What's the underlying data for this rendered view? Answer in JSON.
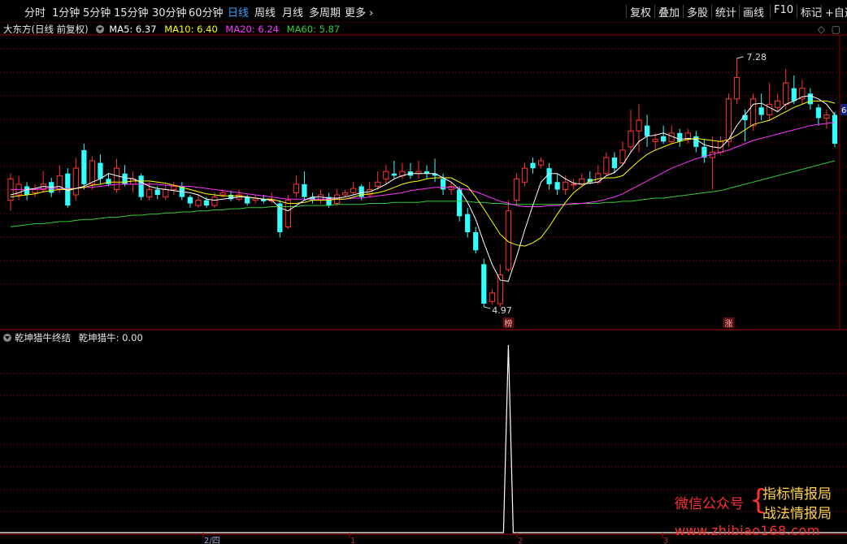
{
  "toolbar": {
    "periods": [
      "分时",
      "1分钟",
      "5分钟",
      "15分钟",
      "30分钟",
      "60分钟",
      "日线",
      "周线",
      "月线",
      "多周期",
      "更多"
    ],
    "active": "日线",
    "right": [
      "复权",
      "叠加",
      "多股",
      "统计",
      "画线",
      "F10",
      "标记",
      "+自选"
    ]
  },
  "header": {
    "stock": "大东方(日线 前复权)",
    "ma5": "MA5: 6.37",
    "ma10": "MA10: 6.40",
    "ma20": "MA20: 6.24",
    "ma60": "MA60: 5.87"
  },
  "colors": {
    "ma5": "#ffffff",
    "ma10": "#ffff00",
    "ma20": "#ff33ff",
    "ma60": "#33cc33",
    "up": "#ff3333",
    "down": "#33ffff",
    "grid": "#8b0000"
  },
  "annotations": {
    "high": "7.28",
    "low": "4.97",
    "badge1": "榜",
    "badge2": "涨",
    "axis_right": "6"
  },
  "indicator": {
    "title": "乾坤猎牛终结",
    "value": "乾坤猎牛: 0.00"
  },
  "xaxis": {
    "labels": [
      "2/四",
      "1",
      "2",
      "3"
    ]
  },
  "watermark": {
    "label": "微信公众号",
    "line1": "指标情报局",
    "line2": "战法情报局",
    "url": "www.zhibiao168.com"
  },
  "chart_data": {
    "type": "candlestick",
    "ylim": [
      4.82,
      7.5
    ],
    "candles": [
      [
        5.95,
        6.15,
        6.2,
        5.85
      ],
      [
        6.0,
        6.1,
        6.18,
        5.95
      ],
      [
        6.08,
        6.0,
        6.12,
        5.95
      ],
      [
        6.02,
        6.05,
        6.1,
        5.98
      ],
      [
        6.05,
        6.1,
        6.22,
        6.02
      ],
      [
        6.12,
        6.02,
        6.16,
        5.98
      ],
      [
        6.05,
        6.18,
        6.28,
        6.02
      ],
      [
        6.2,
        5.9,
        6.25,
        5.88
      ],
      [
        6.0,
        6.25,
        6.35,
        5.95
      ],
      [
        6.42,
        6.1,
        6.48,
        6.05
      ],
      [
        6.1,
        6.32,
        6.36,
        6.05
      ],
      [
        6.3,
        6.15,
        6.38,
        6.1
      ],
      [
        6.15,
        6.1,
        6.2,
        6.08
      ],
      [
        6.05,
        6.25,
        6.34,
        6.02
      ],
      [
        6.2,
        6.1,
        6.28,
        6.08
      ],
      [
        6.1,
        6.15,
        6.22,
        6.02
      ],
      [
        6.18,
        5.98,
        6.2,
        5.95
      ],
      [
        5.98,
        6.05,
        6.12,
        5.95
      ],
      [
        6.05,
        6.0,
        6.08,
        5.96
      ],
      [
        5.98,
        6.05,
        6.1,
        5.95
      ],
      [
        6.05,
        6.08,
        6.12,
        6.0
      ],
      [
        6.08,
        5.98,
        6.12,
        5.95
      ],
      [
        5.98,
        5.92,
        6.0,
        5.88
      ],
      [
        5.9,
        5.95,
        6.0,
        5.88
      ],
      [
        5.95,
        5.9,
        5.98,
        5.88
      ],
      [
        5.9,
        5.98,
        6.02,
        5.88
      ],
      [
        6.0,
        6.02,
        6.05,
        5.98
      ],
      [
        6.0,
        5.96,
        6.04,
        5.94
      ],
      [
        5.96,
        6.0,
        6.05,
        5.94
      ],
      [
        5.98,
        5.92,
        6.0,
        5.9
      ],
      [
        5.95,
        5.97,
        6.0,
        5.92
      ],
      [
        5.96,
        5.94,
        6.0,
        5.92
      ],
      [
        5.95,
        5.95,
        6.02,
        5.92
      ],
      [
        5.92,
        5.65,
        5.95,
        5.6
      ],
      [
        5.7,
        5.95,
        6.0,
        5.68
      ],
      [
        6.02,
        6.1,
        6.18,
        5.98
      ],
      [
        6.1,
        5.98,
        6.22,
        5.95
      ],
      [
        5.98,
        5.95,
        6.02,
        5.92
      ],
      [
        5.95,
        6.0,
        6.05,
        5.92
      ],
      [
        5.98,
        5.9,
        6.02,
        5.88
      ],
      [
        5.92,
        6.0,
        6.05,
        5.9
      ],
      [
        6.0,
        6.02,
        6.05,
        5.98
      ],
      [
        6.02,
        6.06,
        6.12,
        6.0
      ],
      [
        6.08,
        5.98,
        6.1,
        5.95
      ],
      [
        6.0,
        6.05,
        6.12,
        5.98
      ],
      [
        6.08,
        6.12,
        6.22,
        6.05
      ],
      [
        6.15,
        6.22,
        6.28,
        6.1
      ],
      [
        6.2,
        6.18,
        6.32,
        6.15
      ],
      [
        6.18,
        6.22,
        6.3,
        6.15
      ],
      [
        6.22,
        6.18,
        6.3,
        6.15
      ],
      [
        6.2,
        6.22,
        6.32,
        6.15
      ],
      [
        6.22,
        6.2,
        6.28,
        6.15
      ],
      [
        6.2,
        6.18,
        6.34,
        6.12
      ],
      [
        6.15,
        6.05,
        6.2,
        6.0
      ],
      [
        6.05,
        6.08,
        6.12,
        6.0
      ],
      [
        6.05,
        5.8,
        6.08,
        5.75
      ],
      [
        5.82,
        5.65,
        5.88,
        5.6
      ],
      [
        5.65,
        5.48,
        5.7,
        5.45
      ],
      [
        5.35,
        4.98,
        5.4,
        4.95
      ],
      [
        5.0,
        5.08,
        5.12,
        4.97
      ],
      [
        4.98,
        5.25,
        5.35,
        4.95
      ],
      [
        5.3,
        5.85,
        5.95,
        5.28
      ],
      [
        5.95,
        6.15,
        6.2,
        5.9
      ],
      [
        6.12,
        6.25,
        6.3,
        6.08
      ],
      [
        6.3,
        6.25,
        6.35,
        6.2
      ],
      [
        6.28,
        6.32,
        6.35,
        6.25
      ],
      [
        6.25,
        6.1,
        6.3,
        6.05
      ],
      [
        6.12,
        6.05,
        6.2,
        6.0
      ],
      [
        6.05,
        6.12,
        6.18,
        6.0
      ],
      [
        6.1,
        6.1,
        6.15,
        6.05
      ],
      [
        6.1,
        6.15,
        6.2,
        6.08
      ],
      [
        6.15,
        6.12,
        6.22,
        6.1
      ],
      [
        6.12,
        6.2,
        6.28,
        6.1
      ],
      [
        6.2,
        6.35,
        6.4,
        6.18
      ],
      [
        6.35,
        6.25,
        6.4,
        6.2
      ],
      [
        6.3,
        6.42,
        6.5,
        6.28
      ],
      [
        6.45,
        6.6,
        6.8,
        6.4
      ],
      [
        6.6,
        6.7,
        6.85,
        6.4
      ],
      [
        6.65,
        6.55,
        6.75,
        6.45
      ],
      [
        6.5,
        6.52,
        6.58,
        6.42
      ],
      [
        6.55,
        6.5,
        6.65,
        6.48
      ],
      [
        6.5,
        6.58,
        6.65,
        6.48
      ],
      [
        6.58,
        6.5,
        6.62,
        6.45
      ],
      [
        6.52,
        6.58,
        6.62,
        6.48
      ],
      [
        6.55,
        6.45,
        6.6,
        6.4
      ],
      [
        6.45,
        6.35,
        6.52,
        6.3
      ],
      [
        6.35,
        6.4,
        6.55,
        6.05
      ],
      [
        6.4,
        6.5,
        6.55,
        6.38
      ],
      [
        6.5,
        6.9,
        6.95,
        6.45
      ],
      [
        6.9,
        7.1,
        7.28,
        6.85
      ],
      [
        6.75,
        6.7,
        6.8,
        6.5
      ],
      [
        6.65,
        6.9,
        6.95,
        6.6
      ],
      [
        6.82,
        6.75,
        6.95,
        6.7
      ],
      [
        6.75,
        6.85,
        7.05,
        6.7
      ],
      [
        6.82,
        6.88,
        6.95,
        6.78
      ],
      [
        6.85,
        7.05,
        7.18,
        6.8
      ],
      [
        7.0,
        6.88,
        7.12,
        6.85
      ],
      [
        6.9,
        7.0,
        7.08,
        6.85
      ],
      [
        6.95,
        6.85,
        7.0,
        6.8
      ],
      [
        6.82,
        6.72,
        6.85,
        6.65
      ],
      [
        6.72,
        6.75,
        6.8,
        6.62
      ],
      [
        6.75,
        6.48,
        6.78,
        6.45
      ]
    ],
    "ma5": [
      6.0,
      6.02,
      6.05,
      6.06,
      6.08,
      6.07,
      6.08,
      6.04,
      6.06,
      6.08,
      6.12,
      6.15,
      6.2,
      6.18,
      6.16,
      6.15,
      6.12,
      6.08,
      6.06,
      6.05,
      6.04,
      6.03,
      6.02,
      6.0,
      5.96,
      5.95,
      5.96,
      5.97,
      5.98,
      5.98,
      5.97,
      5.96,
      5.95,
      5.88,
      5.85,
      5.9,
      5.95,
      5.98,
      5.98,
      5.97,
      5.97,
      5.98,
      6.0,
      6.02,
      6.03,
      6.06,
      6.1,
      6.15,
      6.18,
      6.2,
      6.2,
      6.2,
      6.2,
      6.16,
      6.12,
      6.05,
      5.93,
      5.77,
      5.55,
      5.35,
      5.2,
      5.19,
      5.42,
      5.67,
      5.9,
      6.12,
      6.2,
      6.2,
      6.15,
      6.11,
      6.1,
      6.11,
      6.12,
      6.18,
      6.21,
      6.28,
      6.4,
      6.5,
      6.55,
      6.56,
      6.58,
      6.55,
      6.52,
      6.53,
      6.52,
      6.47,
      6.45,
      6.44,
      6.52,
      6.65,
      6.75,
      6.85,
      6.86,
      6.82,
      6.78,
      6.85,
      6.88,
      6.92,
      6.93,
      6.9,
      6.85,
      6.75
    ],
    "ma10": [
      5.98,
      5.99,
      6.0,
      6.01,
      6.03,
      6.04,
      6.05,
      6.05,
      6.06,
      6.07,
      6.09,
      6.1,
      6.12,
      6.12,
      6.12,
      6.13,
      6.13,
      6.13,
      6.12,
      6.11,
      6.09,
      6.07,
      6.05,
      6.03,
      6.01,
      6.0,
      5.99,
      5.99,
      5.99,
      5.98,
      5.97,
      5.96,
      5.96,
      5.94,
      5.92,
      5.92,
      5.93,
      5.95,
      5.95,
      5.95,
      5.96,
      5.96,
      5.98,
      6.0,
      6.01,
      6.02,
      6.04,
      6.07,
      6.1,
      6.12,
      6.13,
      6.15,
      6.16,
      6.16,
      6.16,
      6.12,
      6.08,
      5.98,
      5.87,
      5.75,
      5.63,
      5.56,
      5.53,
      5.52,
      5.55,
      5.6,
      5.7,
      5.82,
      5.93,
      6.02,
      6.08,
      6.13,
      6.15,
      6.16,
      6.16,
      6.18,
      6.25,
      6.32,
      6.38,
      6.42,
      6.45,
      6.48,
      6.5,
      6.52,
      6.53,
      6.52,
      6.51,
      6.5,
      6.52,
      6.56,
      6.61,
      6.66,
      6.68,
      6.7,
      6.74,
      6.78,
      6.82,
      6.85,
      6.88,
      6.88,
      6.88,
      6.86
    ],
    "ma20": [
      6.05,
      6.05,
      6.05,
      6.05,
      6.06,
      6.06,
      6.06,
      6.06,
      6.06,
      6.07,
      6.07,
      6.08,
      6.09,
      6.1,
      6.1,
      6.1,
      6.1,
      6.1,
      6.1,
      6.09,
      6.09,
      6.08,
      6.08,
      6.07,
      6.06,
      6.05,
      6.04,
      6.03,
      6.02,
      6.01,
      6.0,
      5.99,
      5.98,
      5.97,
      5.96,
      5.96,
      5.96,
      5.96,
      5.96,
      5.96,
      5.96,
      5.96,
      5.97,
      5.97,
      5.98,
      5.99,
      6.0,
      6.01,
      6.02,
      6.04,
      6.05,
      6.06,
      6.07,
      6.07,
      6.07,
      6.06,
      6.05,
      6.03,
      6.0,
      5.97,
      5.94,
      5.92,
      5.9,
      5.89,
      5.89,
      5.89,
      5.9,
      5.9,
      5.91,
      5.92,
      5.92,
      5.93,
      5.94,
      5.96,
      5.98,
      6.01,
      6.05,
      6.09,
      6.13,
      6.17,
      6.21,
      6.25,
      6.28,
      6.31,
      6.34,
      6.36,
      6.38,
      6.4,
      6.42,
      6.45,
      6.48,
      6.51,
      6.53,
      6.55,
      6.57,
      6.59,
      6.61,
      6.63,
      6.65,
      6.66,
      6.67,
      6.68
    ],
    "ma60": [
      5.7,
      5.71,
      5.72,
      5.73,
      5.73,
      5.74,
      5.75,
      5.75,
      5.76,
      5.77,
      5.77,
      5.78,
      5.79,
      5.79,
      5.8,
      5.81,
      5.81,
      5.82,
      5.82,
      5.83,
      5.83,
      5.84,
      5.84,
      5.85,
      5.85,
      5.86,
      5.86,
      5.87,
      5.87,
      5.88,
      5.88,
      5.88,
      5.89,
      5.89,
      5.89,
      5.89,
      5.9,
      5.9,
      5.9,
      5.9,
      5.91,
      5.91,
      5.91,
      5.91,
      5.92,
      5.92,
      5.92,
      5.93,
      5.93,
      5.93,
      5.93,
      5.94,
      5.94,
      5.94,
      5.94,
      5.94,
      5.94,
      5.93,
      5.93,
      5.92,
      5.92,
      5.91,
      5.91,
      5.91,
      5.91,
      5.91,
      5.91,
      5.91,
      5.91,
      5.91,
      5.92,
      5.92,
      5.92,
      5.93,
      5.93,
      5.94,
      5.94,
      5.95,
      5.96,
      5.97,
      5.97,
      5.98,
      5.99,
      6.0,
      6.01,
      6.02,
      6.03,
      6.04,
      6.06,
      6.08,
      6.1,
      6.12,
      6.14,
      6.16,
      6.18,
      6.2,
      6.22,
      6.24,
      6.26,
      6.28,
      6.3,
      6.32
    ],
    "indicator_values": {
      "index_of_peak": 61,
      "peak": 1,
      "baseline": 0
    }
  }
}
